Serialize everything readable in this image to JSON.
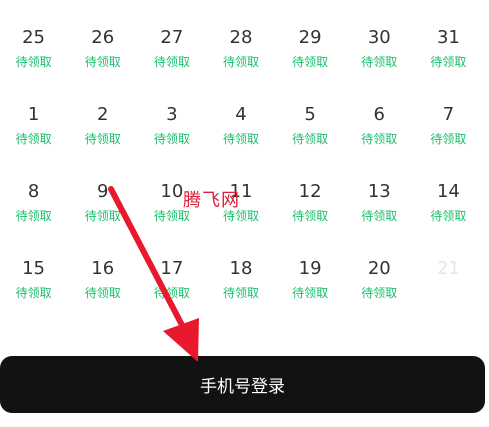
{
  "calendar": {
    "weeks": [
      [
        {
          "day": "25",
          "status": "待领取"
        },
        {
          "day": "26",
          "status": "待领取"
        },
        {
          "day": "27",
          "status": "待领取"
        },
        {
          "day": "28",
          "status": "待领取"
        },
        {
          "day": "29",
          "status": "待领取"
        },
        {
          "day": "30",
          "status": "待领取"
        },
        {
          "day": "31",
          "status": "待领取"
        }
      ],
      [
        {
          "day": "1",
          "status": "待领取"
        },
        {
          "day": "2",
          "status": "待领取"
        },
        {
          "day": "3",
          "status": "待领取"
        },
        {
          "day": "4",
          "status": "待领取"
        },
        {
          "day": "5",
          "status": "待领取"
        },
        {
          "day": "6",
          "status": "待领取"
        },
        {
          "day": "7",
          "status": "待领取"
        }
      ],
      [
        {
          "day": "8",
          "status": "待领取"
        },
        {
          "day": "9",
          "status": "待领取"
        },
        {
          "day": "10",
          "status": "待领取"
        },
        {
          "day": "11",
          "status": "待领取"
        },
        {
          "day": "12",
          "status": "待领取"
        },
        {
          "day": "13",
          "status": "待领取"
        },
        {
          "day": "14",
          "status": "待领取"
        }
      ],
      [
        {
          "day": "15",
          "status": "待领取"
        },
        {
          "day": "16",
          "status": "待领取"
        },
        {
          "day": "17",
          "status": "待领取"
        },
        {
          "day": "18",
          "status": "待领取"
        },
        {
          "day": "19",
          "status": "待领取"
        },
        {
          "day": "20",
          "status": "待领取"
        },
        {
          "day": "21",
          "status": "",
          "disabled": true
        }
      ]
    ]
  },
  "login_button": {
    "label": "手机号登录"
  },
  "watermark": {
    "text": "腾飞网"
  },
  "overlay": {
    "arrow_color": "#e8192c"
  },
  "colors": {
    "status_green": "#19be6b",
    "button_bg": "#121212",
    "disabled_day": "#e6e6e6"
  }
}
